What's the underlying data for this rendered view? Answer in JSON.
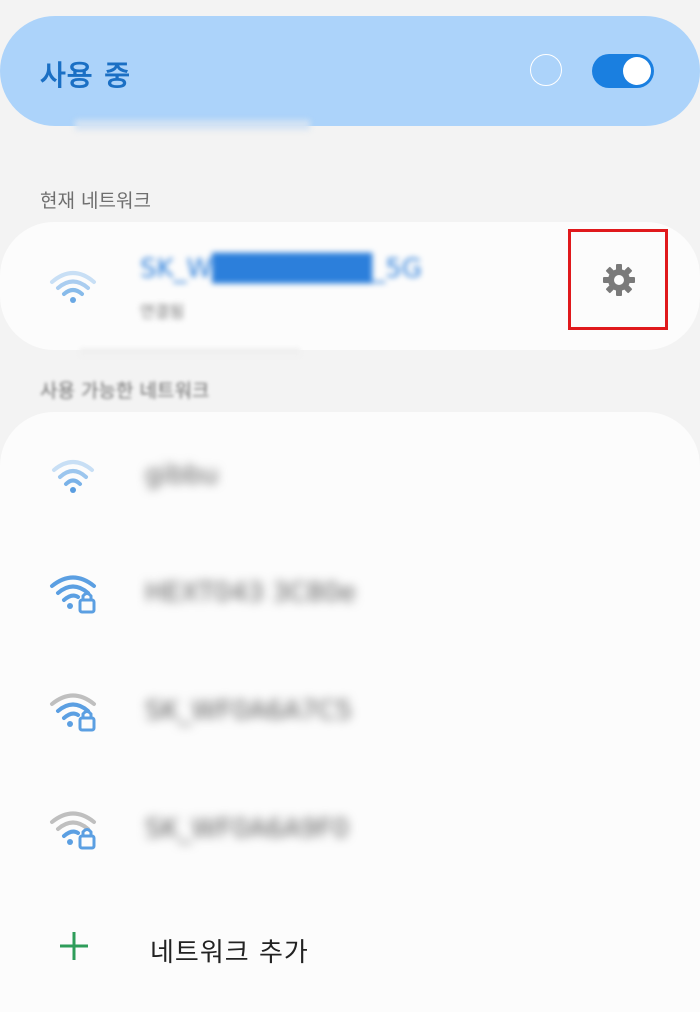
{
  "master": {
    "title": "사용 중",
    "toggle_on": true,
    "colors": {
      "card": "#acd3fa",
      "title": "#1a6fc4",
      "toggle": "#1a7fe0"
    }
  },
  "current_section": {
    "label": "현재 네트워크",
    "network": {
      "name": "SK_W████████_5G",
      "status": "연결됨",
      "icon": "wifi-full-icon",
      "settings_icon": "gear-icon",
      "highlight_color": "#e0191c"
    }
  },
  "available_section": {
    "label": "사용 가능한 네트워크",
    "networks": [
      {
        "name": "gibbu",
        "icon": "wifi-open-icon",
        "locked": false
      },
      {
        "name": "HEXT043 3C80e",
        "icon": "wifi-lock-icon",
        "locked": true
      },
      {
        "name": "SK_WF0A6A7C5",
        "icon": "wifi-lock-icon",
        "locked": true
      },
      {
        "name": "SK_WF0A6A9F0",
        "icon": "wifi-lock-icon",
        "locked": true
      }
    ]
  },
  "add_network": {
    "label": "네트워크 추가",
    "icon": "plus-icon",
    "icon_color": "#2e9d5a"
  }
}
